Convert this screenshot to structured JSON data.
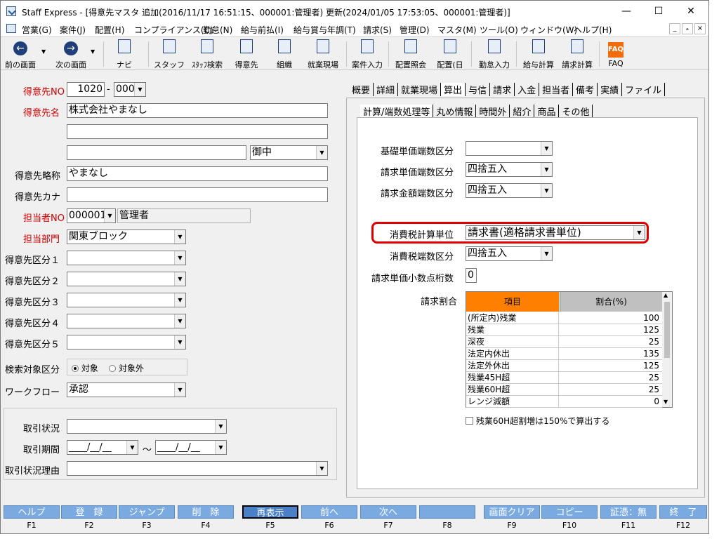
{
  "window": {
    "title": "Staff Express - [得意先マスタ 追加(2016/11/17 16:51:15、000001:管理者) 更新(2024/01/05 17:53:05、000001:管理者)]",
    "min": "—",
    "max": "☐",
    "close": "✕"
  },
  "menu": {
    "items": [
      "営業(G)",
      "案件(J)",
      "配置(H)",
      "コンプライアンス(C)",
      "勤怠(N)",
      "給与前払(I)",
      "給与賞与年調(T)",
      "請求(S)",
      "管理(D)",
      "マスタ(M)",
      "ツール(O)",
      "ウィンドウ(W)",
      "ヘルプ(H)"
    ],
    "min": "_",
    "restore": "ₐ",
    "close": "×"
  },
  "toolbar": {
    "items": [
      "前の画面",
      "次の画面",
      "ナビ",
      "スタッフ",
      "ｽﾀｯﾌ検索",
      "得意先",
      "組織",
      "就業現場",
      "案件入力",
      "配置照会",
      "配置(日",
      "勤怠入力",
      "給与計算",
      "請求計算",
      "FAQ"
    ],
    "faq_icon": "FAQ"
  },
  "form": {
    "customer_no_label": "得意先NO",
    "customer_no": "1020",
    "customer_no_dash": "-",
    "customer_no_sub": "000",
    "customer_name_label": "得意先名",
    "customer_name": "株式会社やまなし",
    "customer_name2": "",
    "customer_name3": "",
    "honorific": "御中",
    "short_name_label": "得意先略称",
    "short_name": "やまなし",
    "kana_label": "得意先カナ",
    "kana": "",
    "staff_no_label": "担当者NO",
    "staff_no": "000001",
    "staff_name": "管理者",
    "dept_label": "担当部門",
    "dept": "関東ブロック",
    "class_labels": [
      "得意先区分１",
      "得意先区分２",
      "得意先区分３",
      "得意先区分４",
      "得意先区分５"
    ],
    "search_label": "検索対象区分",
    "search_on": "対象",
    "search_off": "対象外",
    "workflow_label": "ワークフロー",
    "workflow": "承認",
    "trade_status_label": "取引状況",
    "trade_period_label": "取引期間",
    "trade_period_from": "____/__/__",
    "trade_period_to": "____/__/__",
    "trade_period_sep": "～",
    "trade_reason_label": "取引状況理由"
  },
  "tabs": {
    "main": [
      "概要",
      "詳細",
      "就業現場",
      "算出",
      "与信",
      "請求",
      "入金",
      "担当者",
      "備考",
      "実績",
      "ファイル"
    ],
    "sub": [
      "計算/端数処理等",
      "丸め情報",
      "時間外",
      "紹介",
      "商品",
      "その他"
    ]
  },
  "calc": {
    "base_price_label": "基礎単価端数区分",
    "base_price": "",
    "bill_price_label": "請求単価端数区分",
    "bill_price": "四捨五入",
    "bill_amount_label": "請求金額端数区分",
    "bill_amount": "四捨五入",
    "tax_unit_label": "消費税計算単位",
    "tax_unit": "請求書(適格請求書単位)",
    "tax_round_label": "消費税端数区分",
    "tax_round": "四捨五入",
    "decimal_label": "請求単価小数点桁数",
    "decimal": "0",
    "rate_label": "請求割合",
    "rate_col_item": "項目",
    "rate_col_pct": "割合(%)",
    "rates": [
      {
        "item": "(所定内)残業",
        "pct": "100"
      },
      {
        "item": "残業",
        "pct": "125"
      },
      {
        "item": "深夜",
        "pct": "25"
      },
      {
        "item": "法定内休出",
        "pct": "135"
      },
      {
        "item": "法定外休出",
        "pct": "125"
      },
      {
        "item": "残業45H超",
        "pct": "25"
      },
      {
        "item": "残業60H超",
        "pct": "25"
      },
      {
        "item": "レンジ減額",
        "pct": "0"
      }
    ],
    "ot60_check": "残業60H超割増は150%で算出する"
  },
  "fkeys": [
    {
      "label": "ヘルプ",
      "key": "F1"
    },
    {
      "label": "登　録",
      "key": "F2"
    },
    {
      "label": "ジャンプ",
      "key": "F3"
    },
    {
      "label": "削　除",
      "key": "F4"
    },
    {
      "label": "再表示",
      "key": "F5"
    },
    {
      "label": "前へ",
      "key": "F6"
    },
    {
      "label": "次へ",
      "key": "F7"
    },
    {
      "label": "",
      "key": "F8"
    },
    {
      "label": "画面クリア",
      "key": "F9"
    },
    {
      "label": "コピー",
      "key": "F10"
    },
    {
      "label": "証憑：無",
      "key": "F11"
    },
    {
      "label": "終　了",
      "key": "F12"
    }
  ]
}
